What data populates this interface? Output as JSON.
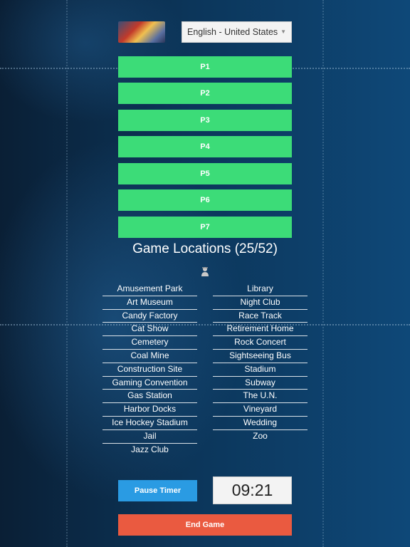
{
  "language": {
    "selected": "English - United States"
  },
  "players": [
    "P1",
    "P2",
    "P3",
    "P4",
    "P5",
    "P6",
    "P7"
  ],
  "locations": {
    "title": "Game Locations (25/52)",
    "left": [
      "Amusement Park",
      "Art Museum",
      "Candy Factory",
      "Cat Show",
      "Cemetery",
      "Coal Mine",
      "Construction Site",
      "Gaming Convention",
      "Gas Station",
      "Harbor Docks",
      "Ice Hockey Stadium",
      "Jail",
      "Jazz Club"
    ],
    "right": [
      "Library",
      "Night Club",
      "Race Track",
      "Retirement Home",
      "Rock Concert",
      "Sightseeing Bus",
      "Stadium",
      "Subway",
      "The U.N.",
      "Vineyard",
      "Wedding",
      "Zoo"
    ]
  },
  "controls": {
    "pause_label": "Pause Timer",
    "timer": "09:21",
    "end_label": "End Game"
  },
  "colors": {
    "player_button": "#3cdc78",
    "pause_button": "#2a9be3",
    "end_button": "#ea5a40"
  }
}
